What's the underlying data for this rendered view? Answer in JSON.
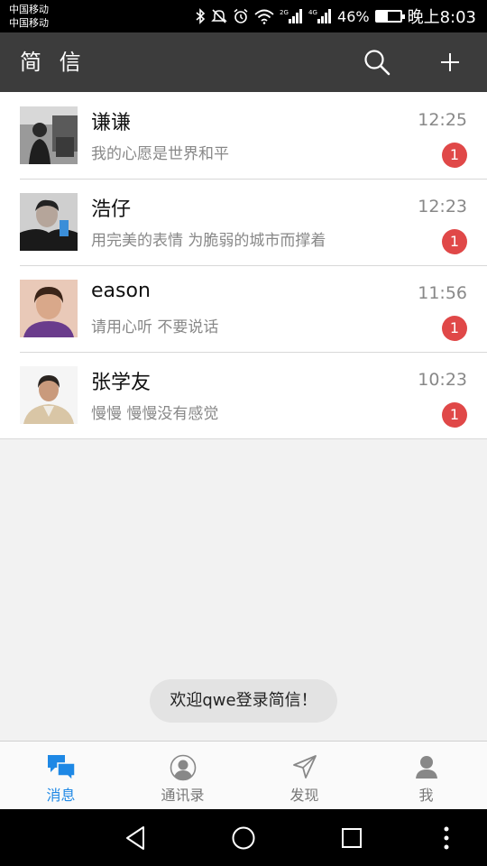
{
  "status_bar": {
    "carrier_1": "中国移动",
    "carrier_2": "中国移动",
    "net_2g": "2G",
    "net_4g": "4G",
    "battery_text": "46%",
    "battery_level": 0.46,
    "time": "晚上8:03",
    "icons": [
      "bluetooth-icon",
      "mute-icon",
      "alarm-icon",
      "wifi-icon",
      "signal-icon",
      "battery-icon"
    ]
  },
  "app_bar": {
    "title": "简 信",
    "actions": [
      "search-icon",
      "plus-icon"
    ]
  },
  "chats": [
    {
      "name": "谦谦",
      "preview": "我的心愿是世界和平",
      "time": "12:25",
      "unread": "1"
    },
    {
      "name": "浩仔",
      "preview": "用完美的表情 为脆弱的城市而撑着",
      "time": "12:23",
      "unread": "1"
    },
    {
      "name": "eason",
      "preview": "请用心听 不要说话",
      "time": "11:56",
      "unread": "1"
    },
    {
      "name": "张学友",
      "preview": "慢慢 慢慢没有感觉",
      "time": "10:23",
      "unread": "1"
    }
  ],
  "toast": {
    "text": "欢迎qwe登录简信！"
  },
  "bottom_nav": {
    "active_index": 0,
    "active_color": "#1e88e5",
    "tabs": [
      {
        "label": "消息",
        "icon": "messages-icon"
      },
      {
        "label": "通讯录",
        "icon": "contacts-icon"
      },
      {
        "label": "发现",
        "icon": "send-icon"
      },
      {
        "label": "我",
        "icon": "person-icon"
      }
    ]
  },
  "system_nav": {
    "buttons": [
      "back-icon",
      "home-icon",
      "recents-icon",
      "more-vert-icon"
    ]
  }
}
